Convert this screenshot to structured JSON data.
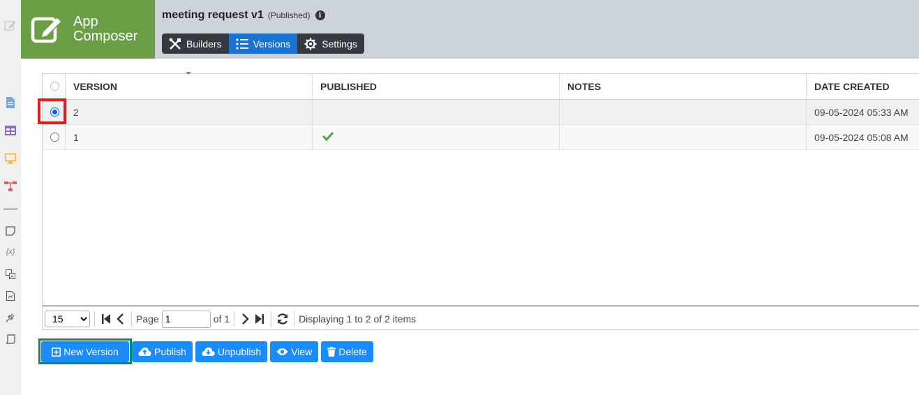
{
  "app": {
    "brand_line1": "App",
    "brand_line2": "Composer"
  },
  "header": {
    "title": "meeting request v1",
    "status": "(Published)",
    "tabs": [
      {
        "label": "Builders",
        "icon": "tools-icon",
        "active": false
      },
      {
        "label": "Versions",
        "icon": "list-icon",
        "active": true
      },
      {
        "label": "Settings",
        "icon": "gear-icon",
        "active": false
      }
    ]
  },
  "grid": {
    "columns": [
      "VERSION",
      "PUBLISHED",
      "NOTES",
      "DATE CREATED"
    ],
    "rows": [
      {
        "version": "2",
        "published": false,
        "notes": "",
        "date_created": "09-05-2024 05:33 AM",
        "selected": true
      },
      {
        "version": "1",
        "published": true,
        "notes": "",
        "date_created": "09-05-2024 05:08 AM",
        "selected": false
      }
    ]
  },
  "pager": {
    "page_size": "15",
    "page_label": "Page",
    "page_value": "1",
    "of_label": "of 1",
    "display_text": "Displaying 1 to 2 of 2 items"
  },
  "actions": {
    "new_version": "New Version",
    "publish": "Publish",
    "unpublish": "Unpublish",
    "view": "View",
    "delete": "Delete"
  },
  "colors": {
    "brand": "#6a9f46",
    "accent": "#1a8cff",
    "active_tab": "#1a73d1",
    "highlight_red": "#e01e1e",
    "highlight_green": "#0a8a63"
  }
}
